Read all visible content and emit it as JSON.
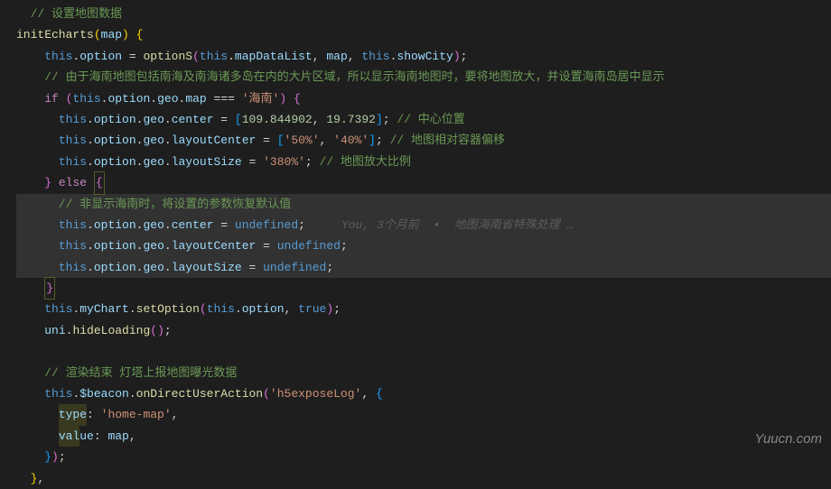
{
  "watermark": "Yuucn.com",
  "gitlens": {
    "author": "You",
    "when": "3个月前",
    "sep": "•",
    "msg": "地图海南省特殊处理 …"
  },
  "lines": {
    "l1_comment": "  // 设置地图数据",
    "l2_func": "initEcharts",
    "l2_param": "map",
    "l3_assign1": "option",
    "l3_fn": "optionS",
    "l3_a1": "mapDataList",
    "l3_a2": "map",
    "l3_a3": "showCity",
    "l4_comment": "    // 由于海南地图包括南海及南海诸多岛在内的大片区域，所以显示海南地图时，要将地图放大，并设置海南岛居中显示",
    "l5_if": "if",
    "l5_opt": "option",
    "l5_geo": "geo",
    "l5_map": "map",
    "l5_str": "'海南'",
    "l6_center": "center",
    "l6_n1": "109.844902",
    "l6_n2": "19.7392",
    "l6_c": "// 中心位置",
    "l7_layoutCenter": "layoutCenter",
    "l7_s1": "'50%'",
    "l7_s2": "'40%'",
    "l7_c": "// 地图相对容器偏移",
    "l8_layoutSize": "layoutSize",
    "l8_s": "'380%'",
    "l8_c": "// 地图放大比例",
    "l9_else": "else",
    "l10_c": "      // 非显示海南时，将设置的参数恢复默认值",
    "l11_undef": "undefined",
    "l13_myChart": "myChart",
    "l13_setOption": "setOption",
    "l13_true": "true",
    "l14_uni": "uni",
    "l14_hide": "hideLoading",
    "l16_c": "    // 渲染结束 灯塔上报地图曝光数据",
    "l17_beacon": "$beacon",
    "l17_action": "onDirectUserAction",
    "l17_s": "'h5exposeLog'",
    "l18_type": "type",
    "l18_v": "'home-map'",
    "l19_value": "value",
    "l19_v": "map"
  }
}
